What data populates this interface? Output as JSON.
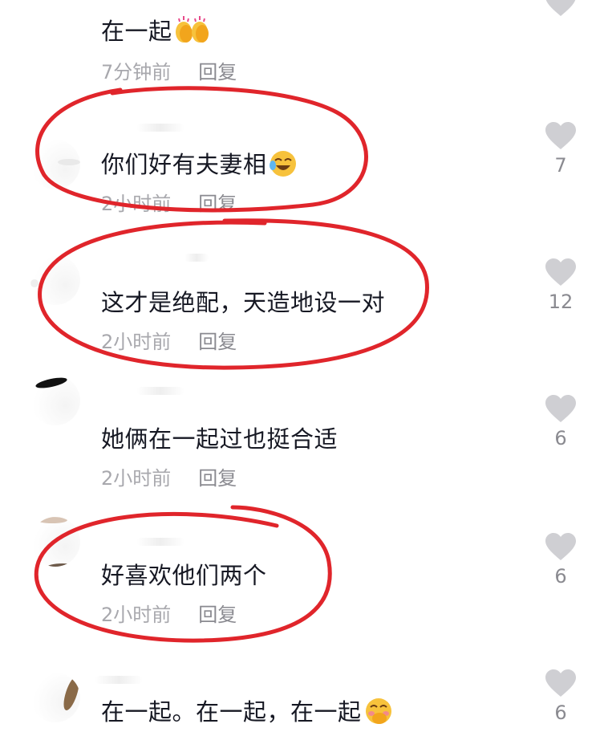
{
  "comments": [
    {
      "text": "在一起",
      "time": "7分钟前",
      "reply": "回复",
      "likes": "",
      "emoji": [
        "clapping-hands-icon",
        "clapping-hands-icon"
      ],
      "highlighted": false
    },
    {
      "text": "你们好有夫妻相",
      "time": "2小时前",
      "reply": "回复",
      "likes": "7",
      "emoji": [
        "laughing-crying-icon"
      ],
      "highlighted": true
    },
    {
      "text": "这才是绝配，天造地设一对",
      "time": "2小时前",
      "reply": "回复",
      "likes": "12",
      "emoji": [],
      "highlighted": true
    },
    {
      "text": "她俩在一起过也挺合适",
      "time": "2小时前",
      "reply": "回复",
      "likes": "6",
      "emoji": [],
      "highlighted": false
    },
    {
      "text": "好喜欢他们两个",
      "time": "2小时前",
      "reply": "回复",
      "likes": "6",
      "emoji": [],
      "highlighted": true
    },
    {
      "text": "在一起。在一起，在一起",
      "time": "",
      "reply": "",
      "likes": "6",
      "emoji": [
        "hand-over-mouth-icon"
      ],
      "highlighted": false
    }
  ],
  "colors": {
    "text": "#161823",
    "meta": "#a8a8ad",
    "heart": "#cfcfd3",
    "annotation": "#e0252b"
  }
}
